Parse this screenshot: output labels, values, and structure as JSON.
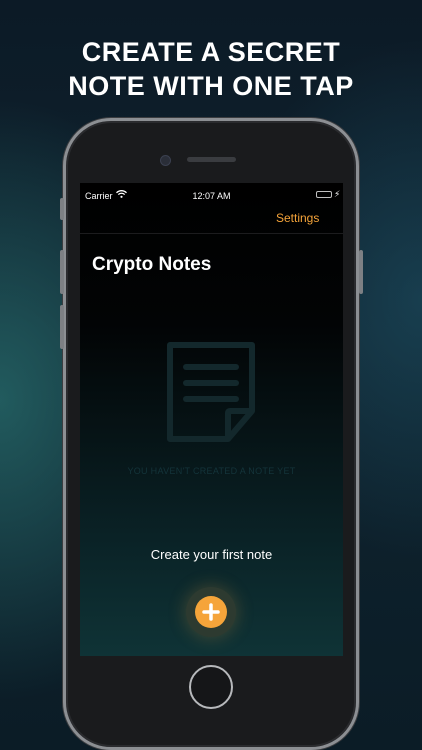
{
  "headline": {
    "line1": "CREATE A SECRET",
    "line2": "NOTE WITH ONE TAP"
  },
  "status_bar": {
    "carrier": "Carrier",
    "time": "12:07 AM",
    "battery_level": 1.0
  },
  "nav": {
    "settings_label": "Settings"
  },
  "page": {
    "title": "Crypto Notes"
  },
  "empty_state": {
    "message": "YOU HAVEN'T CREATED A NOTE YET",
    "icon": "document-icon"
  },
  "cta": {
    "text": "Create your first note",
    "button_icon": "plus-icon"
  },
  "colors": {
    "accent": "#f5a43a",
    "battery": "#3ad14a"
  }
}
